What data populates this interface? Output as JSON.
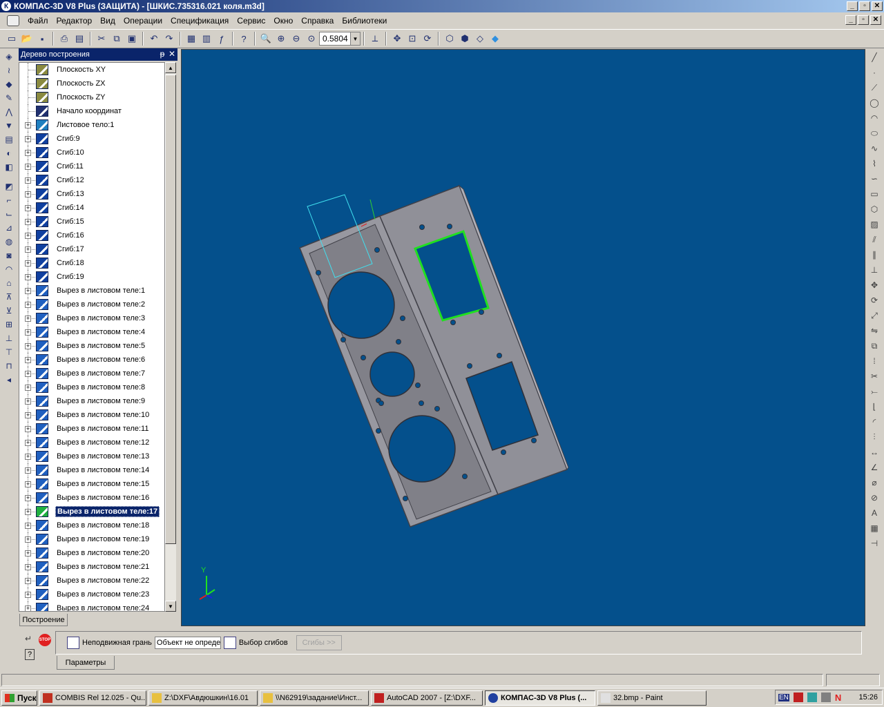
{
  "window": {
    "title": "КОМПАС-3D V8 Plus (ЗАЩИТА) - [ШКИС.735316.021 коля.m3d]",
    "minimize": "_",
    "maximize": "▫",
    "close": "✕"
  },
  "menu": {
    "items": [
      "Файл",
      "Редактор",
      "Вид",
      "Операции",
      "Спецификация",
      "Сервис",
      "Окно",
      "Справка",
      "Библиотеки"
    ]
  },
  "toolbar": {
    "zoom_value": "0.5804",
    "icons": [
      "new-icon",
      "open-icon",
      "save-icon",
      "print-icon",
      "cut-icon",
      "copy-icon",
      "paste-icon",
      "undo-icon",
      "redo-icon",
      "variables-icon",
      "fx-icon",
      "help-icon",
      "zoom-window-icon",
      "zoom-in-icon",
      "zoom-out-icon",
      "zoom-scale-icon",
      "orientation-icon",
      "pan-icon",
      "zoom-all-icon",
      "rotate-icon",
      "wireframe-icon",
      "hidden-lines-icon",
      "shaded-icon"
    ]
  },
  "tree": {
    "title": "Дерево построения",
    "pin": "ᵽ",
    "close": "✕",
    "tab_label": "Построение",
    "items": [
      {
        "label": "Плоскость XY",
        "icon": "plane-icon",
        "expandable": false
      },
      {
        "label": "Плоскость ZX",
        "icon": "plane-icon",
        "expandable": false
      },
      {
        "label": "Плоскость ZY",
        "icon": "plane-icon",
        "expandable": false
      },
      {
        "label": "Начало координат",
        "icon": "origin-icon",
        "expandable": false
      },
      {
        "label": "Листовое тело:1",
        "icon": "sheet-body-icon",
        "expandable": true
      },
      {
        "label": "Сгиб:9",
        "icon": "bend-icon",
        "expandable": true
      },
      {
        "label": "Сгиб:10",
        "icon": "bend-icon",
        "expandable": true
      },
      {
        "label": "Сгиб:11",
        "icon": "bend-icon",
        "expandable": true
      },
      {
        "label": "Сгиб:12",
        "icon": "bend-icon",
        "expandable": true
      },
      {
        "label": "Сгиб:13",
        "icon": "bend-icon",
        "expandable": true
      },
      {
        "label": "Сгиб:14",
        "icon": "bend-icon",
        "expandable": true
      },
      {
        "label": "Сгиб:15",
        "icon": "bend-icon",
        "expandable": true
      },
      {
        "label": "Сгиб:16",
        "icon": "bend-icon",
        "expandable": true
      },
      {
        "label": "Сгиб:17",
        "icon": "bend-icon",
        "expandable": true
      },
      {
        "label": "Сгиб:18",
        "icon": "bend-icon",
        "expandable": true
      },
      {
        "label": "Сгиб:19",
        "icon": "bend-icon",
        "expandable": true
      },
      {
        "label": "Вырез в листовом теле:1",
        "icon": "cut-in-sheet-icon",
        "expandable": true
      },
      {
        "label": "Вырез в листовом теле:2",
        "icon": "cut-in-sheet-icon",
        "expandable": true
      },
      {
        "label": "Вырез в листовом теле:3",
        "icon": "cut-in-sheet-icon",
        "expandable": true
      },
      {
        "label": "Вырез в листовом теле:4",
        "icon": "cut-in-sheet-icon",
        "expandable": true
      },
      {
        "label": "Вырез в листовом теле:5",
        "icon": "cut-in-sheet-icon",
        "expandable": true
      },
      {
        "label": "Вырез в листовом теле:6",
        "icon": "cut-in-sheet-icon",
        "expandable": true
      },
      {
        "label": "Вырез в листовом теле:7",
        "icon": "cut-in-sheet-icon",
        "expandable": true
      },
      {
        "label": "Вырез в листовом теле:8",
        "icon": "cut-in-sheet-icon",
        "expandable": true
      },
      {
        "label": "Вырез в листовом теле:9",
        "icon": "cut-in-sheet-icon",
        "expandable": true
      },
      {
        "label": "Вырез в листовом теле:10",
        "icon": "cut-in-sheet-icon",
        "expandable": true
      },
      {
        "label": "Вырез в листовом теле:11",
        "icon": "cut-in-sheet-icon",
        "expandable": true
      },
      {
        "label": "Вырез в листовом теле:12",
        "icon": "cut-in-sheet-icon",
        "expandable": true
      },
      {
        "label": "Вырез в листовом теле:13",
        "icon": "cut-in-sheet-icon",
        "expandable": true
      },
      {
        "label": "Вырез в листовом теле:14",
        "icon": "cut-in-sheet-icon",
        "expandable": true
      },
      {
        "label": "Вырез в листовом теле:15",
        "icon": "cut-in-sheet-icon",
        "expandable": true
      },
      {
        "label": "Вырез в листовом теле:16",
        "icon": "cut-in-sheet-icon",
        "expandable": true
      },
      {
        "label": "Вырез в листовом теле:17",
        "icon": "cut-in-sheet-icon",
        "expandable": true,
        "selected": true
      },
      {
        "label": "Вырез в листовом теле:18",
        "icon": "cut-in-sheet-icon",
        "expandable": true
      },
      {
        "label": "Вырез в листовом теле:19",
        "icon": "cut-in-sheet-icon",
        "expandable": true
      },
      {
        "label": "Вырез в листовом теле:20",
        "icon": "cut-in-sheet-icon",
        "expandable": true
      },
      {
        "label": "Вырез в листовом теле:21",
        "icon": "cut-in-sheet-icon",
        "expandable": true
      },
      {
        "label": "Вырез в листовом теле:22",
        "icon": "cut-in-sheet-icon",
        "expandable": true
      },
      {
        "label": "Вырез в листовом теле:23",
        "icon": "cut-in-sheet-icon",
        "expandable": true
      },
      {
        "label": "Вырез в листовом теле:24",
        "icon": "cut-in-sheet-icon",
        "expandable": true
      }
    ]
  },
  "viewport": {
    "background": "#04508c",
    "axis_y": "Y",
    "highlight_color": "#20e020"
  },
  "props": {
    "fixed_face_label": "Неподвижная грань",
    "object_field": "Объект не определ",
    "bend_select_label": "Выбор сгибов",
    "bends_button": "Сгибы  >>",
    "tab_label": "Параметры",
    "stop_label": "STOP"
  },
  "taskbar": {
    "start": "Пуск",
    "tasks": [
      {
        "label": "COMBIS Rel 12.025 - Qu...",
        "active": false
      },
      {
        "label": "Z:\\DXF\\Авдюшкин\\16.01",
        "active": false
      },
      {
        "label": "\\\\N62919\\задание\\Инст...",
        "active": false
      },
      {
        "label": "AutoCAD 2007 - [Z:\\DXF...",
        "active": false
      },
      {
        "label": "КОМПАС-3D V8 Plus (...",
        "active": true
      },
      {
        "label": "32.bmp - Paint",
        "active": false
      }
    ],
    "lang": "EN",
    "clock": "15:26"
  }
}
